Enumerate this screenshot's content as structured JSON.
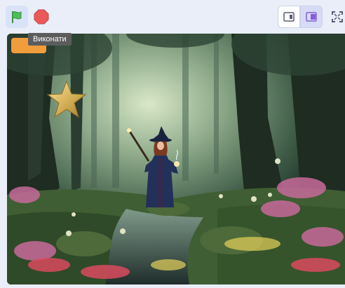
{
  "toolbar": {
    "green_flag_icon": "green-flag-icon",
    "stop_icon": "stop-icon",
    "small_stage_icon": "small-stage-icon",
    "normal_stage_icon": "normal-stage-icon",
    "fullscreen_icon": "fullscreen-icon",
    "tooltip": "Виконати"
  },
  "colors": {
    "flag": "#4cbf56",
    "stop": "#ec5959",
    "accent": "#855cd6",
    "toolbar_bg": "#e9eef8",
    "orange_button": "#f29d3b"
  },
  "stage": {
    "sprites": [
      "star-sprite",
      "witch-sprite"
    ],
    "backdrop": "enchanted-forest-backdrop"
  }
}
